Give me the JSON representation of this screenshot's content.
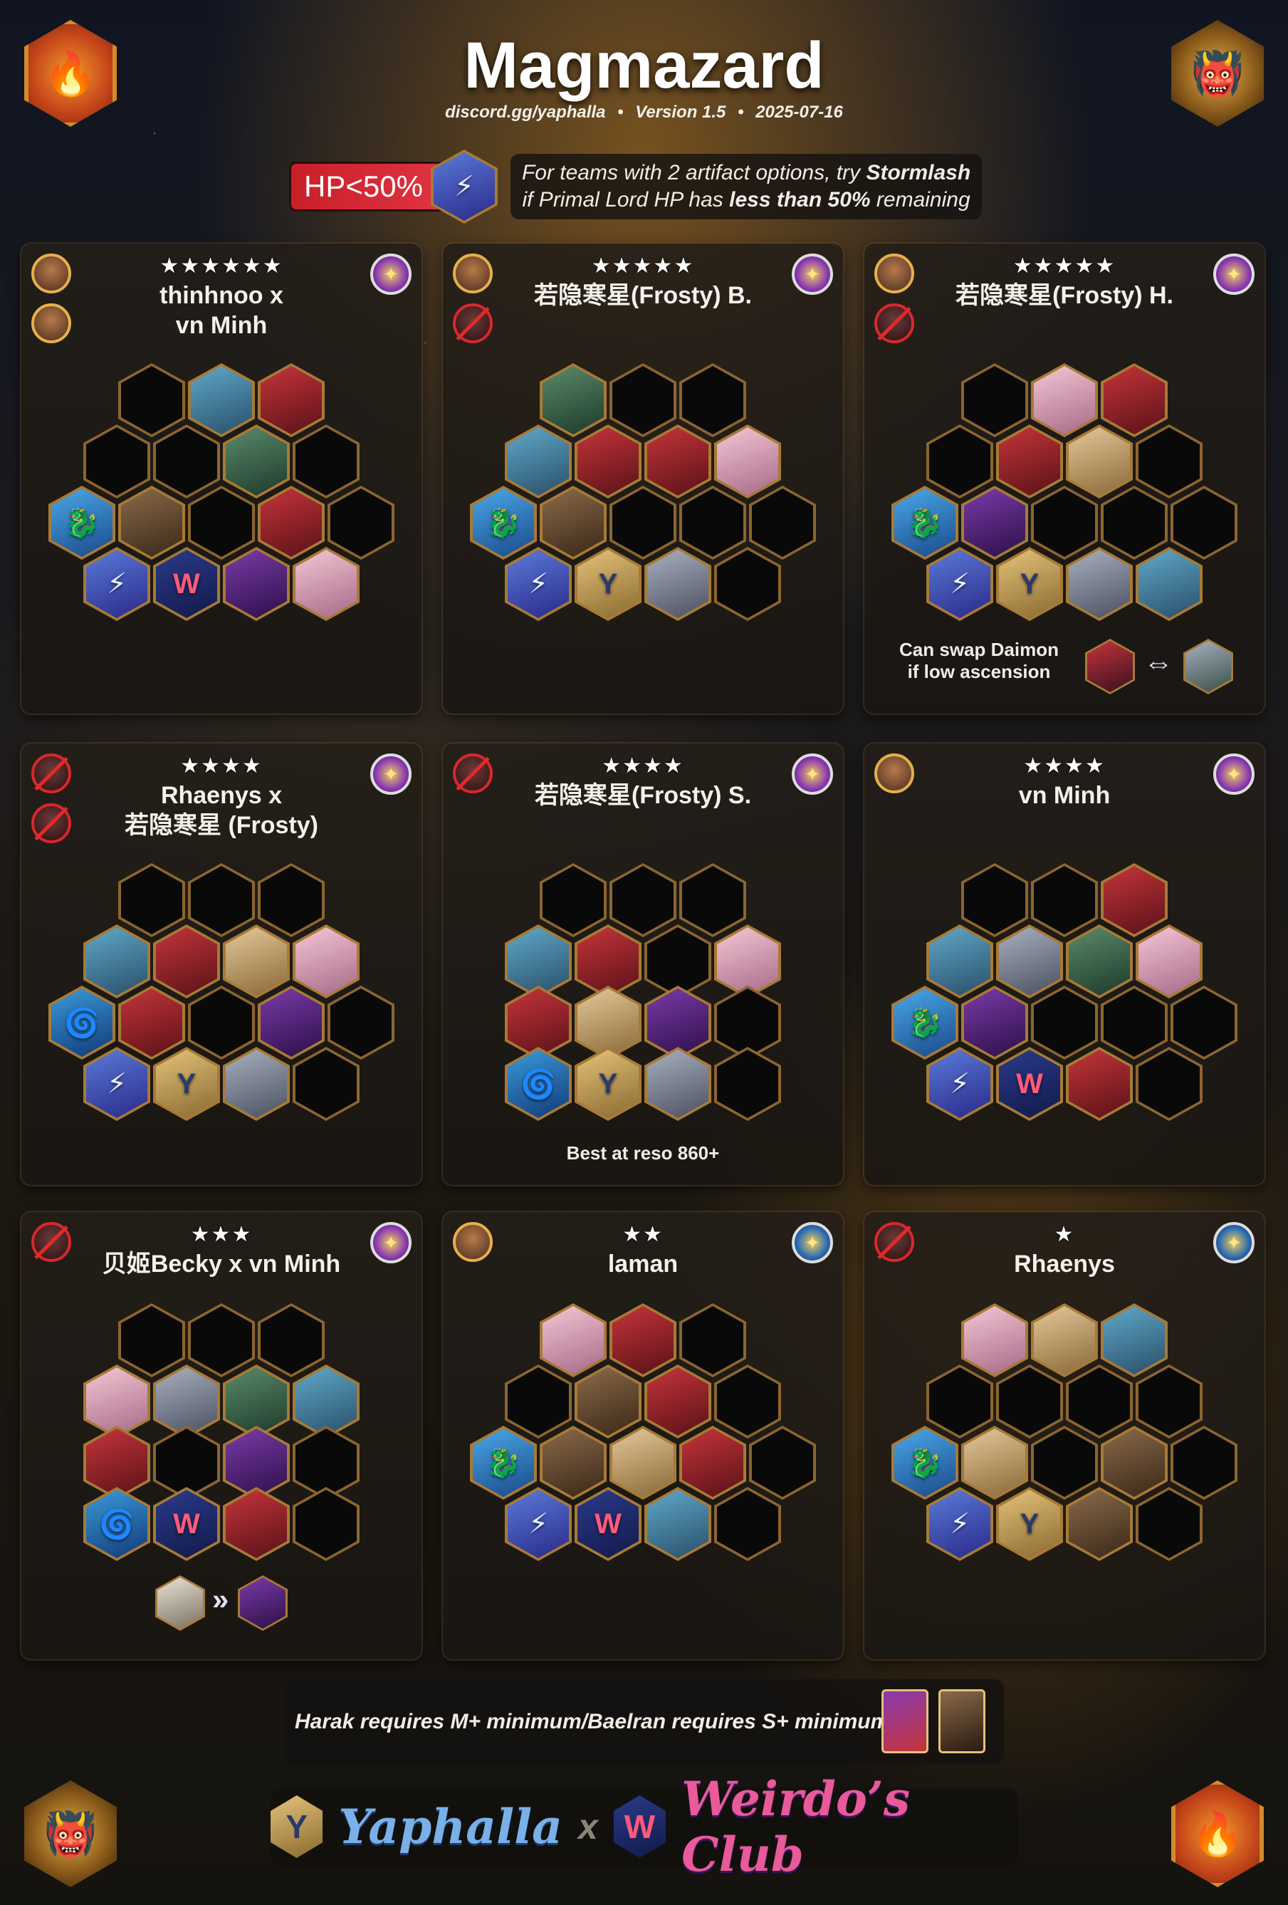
{
  "header": {
    "title": "Magmazard",
    "link": "discord.gg/yaphalla",
    "version": "Version 1.5",
    "date": "2025-07-16",
    "separator": "•"
  },
  "hp_tip": {
    "tag": "HP<50%",
    "line1_prefix": "For teams with 2 artifact options, try ",
    "line1_bold": "Stormlash",
    "line2_prefix": "if Primal Lord HP has ",
    "line2_bold": "less than 50%",
    "line2_suffix": " remaining"
  },
  "colors": {
    "accent_gold": "#c58a2b",
    "hp_red": "#d8282c",
    "card_bg": "#231e18"
  },
  "icons": {
    "stormlash": "⚡",
    "dragon": "🐉",
    "swirl": "🌀",
    "y_artifact": "Y",
    "w_artifact": "W",
    "star": "★",
    "faction": "✦",
    "fire_emblem": "🔥",
    "boss_emblem": "👹",
    "swap": "⇔",
    "upgrade": "»"
  },
  "cards": [
    {
      "stars": "★★★★★★",
      "name": "thinhnoo x\nvn Minh",
      "note": ""
    },
    {
      "stars": "★★★★★",
      "name": "若隐寒星(Frosty) B.",
      "note": ""
    },
    {
      "stars": "★★★★★",
      "name": "若隐寒星(Frosty) H.",
      "note": "Can swap Daimon\nif low ascension"
    },
    {
      "stars": "★★★★",
      "name": "Rhaenys x\n若隐寒星 (Frosty)",
      "note": ""
    },
    {
      "stars": "★★★★",
      "name": "若隐寒星(Frosty) S.",
      "note": "Best at reso 860+"
    },
    {
      "stars": "★★★★",
      "name": "vn Minh",
      "note": ""
    },
    {
      "stars": "★★★",
      "name": "贝姬Becky x vn Minh",
      "note": ""
    },
    {
      "stars": "★★",
      "name": "laman",
      "note": ""
    },
    {
      "stars": "★",
      "name": "Rhaenys",
      "note": ""
    }
  ],
  "footer": {
    "requirement": "Harak requires M+ minimum/Baelran requires S+ minimum",
    "brand_left": "Yaphalla",
    "brand_x": "x",
    "brand_right": "Weirdo’s Club"
  }
}
